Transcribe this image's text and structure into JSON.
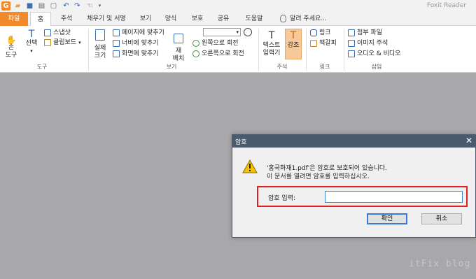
{
  "app": {
    "title": "Foxit Reader",
    "logo_letter": "G"
  },
  "quick_access": [
    "open-icon",
    "save-icon",
    "print-icon",
    "copy-icon",
    "undo-icon",
    "redo-icon",
    "hand-icon"
  ],
  "tabs": [
    "파일",
    "홈",
    "주석",
    "채우기 및 서명",
    "보기",
    "양식",
    "보호",
    "공유",
    "도움말"
  ],
  "tell_me": "알려 주세요...",
  "ribbon": {
    "tools": {
      "hand_1": "손",
      "hand_2": "도구",
      "select_1": "선택",
      "select_arrow": "▾",
      "snapshot": "스냅샷",
      "clipboard": "클립보드",
      "label": "도구"
    },
    "view": {
      "actual_1": "실제",
      "actual_2": "크기",
      "fit_page": "페이지에 맞추기",
      "fit_width": "너비에 맞추기",
      "fit_visible": "화면에 맞추기",
      "reflow_1": "재",
      "reflow_2": "배치",
      "rotate_left": "왼쪽으로 회전",
      "rotate_right": "오른쪽으로 회전",
      "zoom_value": "",
      "label": "보기"
    },
    "comment": {
      "typewriter_1": "텍스트",
      "typewriter_2": "입력기",
      "highlight": "강조",
      "label": "주석"
    },
    "links": {
      "link": "링크",
      "bookmark": "책갈피",
      "label": "링크"
    },
    "insert": {
      "attachment": "첨부 파일",
      "image_annot": "이미지 주석",
      "audio_video": "오디오 & 비디오",
      "label": "삽입"
    }
  },
  "dialog": {
    "title": "암호",
    "message_1": "'홍국화재1.pdf'은 암호로 보호되어 있습니다.",
    "message_2": "이 문서를 열려면 암호를 입력하십시오.",
    "password_label": "암호 입력:",
    "password_value": "",
    "ok": "확인",
    "cancel": "취소"
  },
  "watermark": "itFix blog",
  "colors": {
    "accent": "#f18a2b",
    "dialog_title": "#4a5a6f",
    "highlight_frame": "#e02020",
    "workspace": "#a8a8ab"
  }
}
